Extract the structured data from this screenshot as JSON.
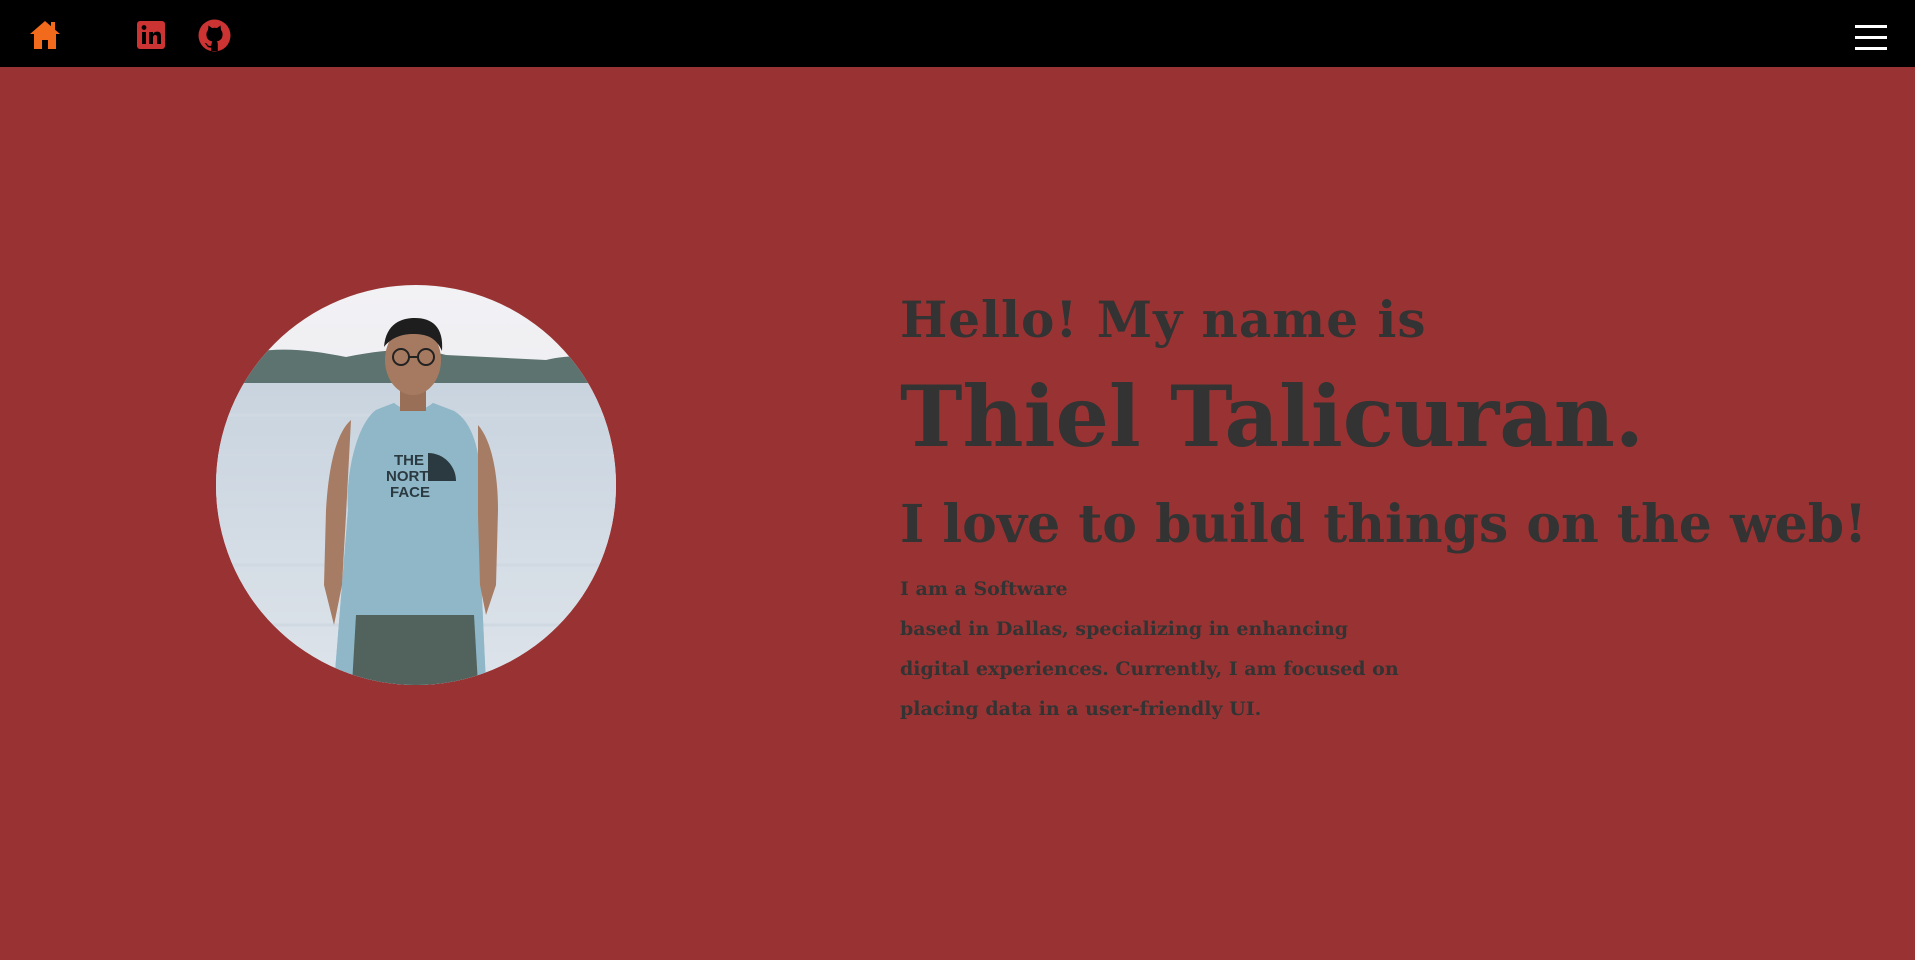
{
  "nav": {
    "home_icon": "home-icon",
    "linkedin_icon": "linkedin-icon",
    "github_icon": "github-icon",
    "menu_icon": "hamburger-menu-icon",
    "home_color": "#f26a1b",
    "social_color": "#cc3333"
  },
  "hero": {
    "greeting": "Hello! My name is",
    "name": "Thiel Talicuran.",
    "tagline": "I love to build things on the web!",
    "bio_lines": [
      "I am a Software",
      "based in Dallas, specializing in enhancing",
      "digital experiences. Currently, I am focused on",
      "placing data in a user-friendly UI."
    ]
  },
  "colors": {
    "background": "#993333",
    "topbar": "#000000",
    "text": "#333333"
  }
}
